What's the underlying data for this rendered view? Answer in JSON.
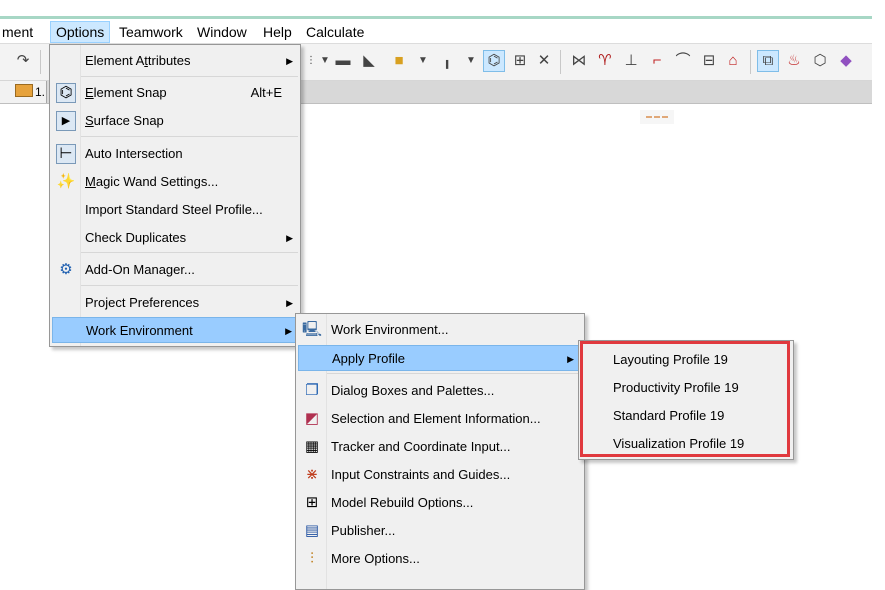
{
  "menubar": {
    "items": [
      {
        "label": "ment"
      },
      {
        "label": "Options"
      },
      {
        "label": "Teamwork"
      },
      {
        "label": "Window"
      },
      {
        "label": "Help"
      },
      {
        "label": "Calculate"
      }
    ]
  },
  "tab": {
    "label": "1."
  },
  "options_menu": {
    "items": [
      {
        "label_pre": "Element A",
        "label_u": "t",
        "label_post": "tributes",
        "has_submenu": true
      },
      {
        "label_pre": "",
        "label_u": "E",
        "label_post": "lement Snap",
        "shortcut": "Alt+E"
      },
      {
        "label_pre": "",
        "label_u": "S",
        "label_post": "urface Snap"
      },
      {
        "label_pre": "Auto Intersection",
        "label_u": "",
        "label_post": ""
      },
      {
        "label_pre": "",
        "label_u": "M",
        "label_post": "agic Wand Settings..."
      },
      {
        "label_pre": "Import Standard Steel Profile...",
        "label_u": "",
        "label_post": ""
      },
      {
        "label_pre": "Check Duplicates",
        "label_u": "",
        "label_post": "",
        "has_submenu": true
      },
      {
        "label_pre": "Add-On Manager...",
        "label_u": "",
        "label_post": ""
      },
      {
        "label_pre": "Project Preferences",
        "label_u": "",
        "label_post": "",
        "has_submenu": true
      },
      {
        "label_pre": "Work Environment",
        "label_u": "",
        "label_post": "",
        "has_submenu": true
      }
    ]
  },
  "work_env_menu": {
    "items": [
      {
        "label": "Work Environment..."
      },
      {
        "label": "Apply Profile",
        "has_submenu": true
      },
      {
        "label": "Dialog Boxes and Palettes..."
      },
      {
        "label": "Selection and Element Information..."
      },
      {
        "label": "Tracker and Coordinate Input..."
      },
      {
        "label": "Input Constraints and Guides..."
      },
      {
        "label": "Model Rebuild Options..."
      },
      {
        "label": "Publisher..."
      },
      {
        "label": "More Options..."
      }
    ]
  },
  "profile_menu": {
    "items": [
      {
        "label": "Layouting Profile 19"
      },
      {
        "label": "Productivity Profile 19"
      },
      {
        "label": "Standard Profile 19"
      },
      {
        "label": "Visualization Profile 19"
      }
    ]
  },
  "colors": {
    "highlight": "#99ccff",
    "menu_bg": "#f0f0f0",
    "callout": "#e0393e"
  }
}
